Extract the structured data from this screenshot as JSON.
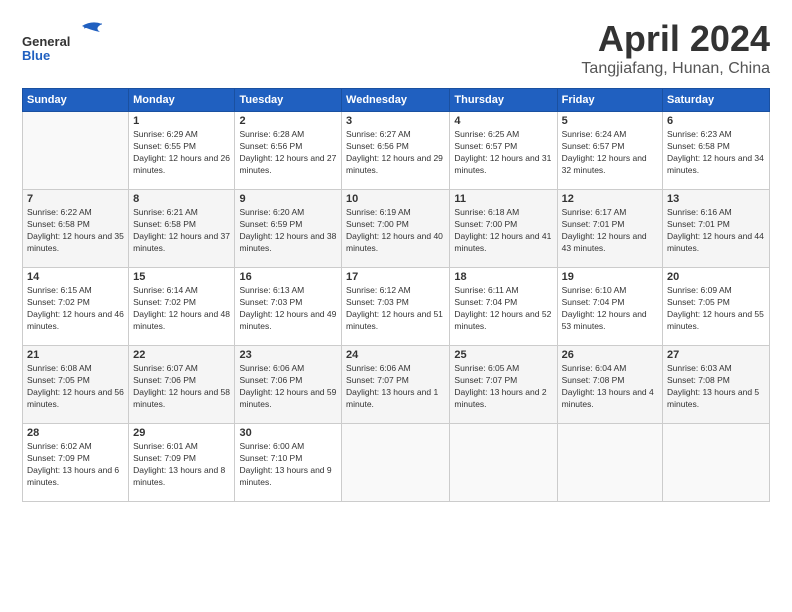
{
  "header": {
    "logo_general": "General",
    "logo_blue": "Blue",
    "month_title": "April 2024",
    "location": "Tangjiafang, Hunan, China"
  },
  "weekdays": [
    "Sunday",
    "Monday",
    "Tuesday",
    "Wednesday",
    "Thursday",
    "Friday",
    "Saturday"
  ],
  "weeks": [
    [
      {
        "day": "",
        "sunrise": "",
        "sunset": "",
        "daylight": ""
      },
      {
        "day": "1",
        "sunrise": "Sunrise: 6:29 AM",
        "sunset": "Sunset: 6:55 PM",
        "daylight": "Daylight: 12 hours and 26 minutes."
      },
      {
        "day": "2",
        "sunrise": "Sunrise: 6:28 AM",
        "sunset": "Sunset: 6:56 PM",
        "daylight": "Daylight: 12 hours and 27 minutes."
      },
      {
        "day": "3",
        "sunrise": "Sunrise: 6:27 AM",
        "sunset": "Sunset: 6:56 PM",
        "daylight": "Daylight: 12 hours and 29 minutes."
      },
      {
        "day": "4",
        "sunrise": "Sunrise: 6:25 AM",
        "sunset": "Sunset: 6:57 PM",
        "daylight": "Daylight: 12 hours and 31 minutes."
      },
      {
        "day": "5",
        "sunrise": "Sunrise: 6:24 AM",
        "sunset": "Sunset: 6:57 PM",
        "daylight": "Daylight: 12 hours and 32 minutes."
      },
      {
        "day": "6",
        "sunrise": "Sunrise: 6:23 AM",
        "sunset": "Sunset: 6:58 PM",
        "daylight": "Daylight: 12 hours and 34 minutes."
      }
    ],
    [
      {
        "day": "7",
        "sunrise": "Sunrise: 6:22 AM",
        "sunset": "Sunset: 6:58 PM",
        "daylight": "Daylight: 12 hours and 35 minutes."
      },
      {
        "day": "8",
        "sunrise": "Sunrise: 6:21 AM",
        "sunset": "Sunset: 6:58 PM",
        "daylight": "Daylight: 12 hours and 37 minutes."
      },
      {
        "day": "9",
        "sunrise": "Sunrise: 6:20 AM",
        "sunset": "Sunset: 6:59 PM",
        "daylight": "Daylight: 12 hours and 38 minutes."
      },
      {
        "day": "10",
        "sunrise": "Sunrise: 6:19 AM",
        "sunset": "Sunset: 7:00 PM",
        "daylight": "Daylight: 12 hours and 40 minutes."
      },
      {
        "day": "11",
        "sunrise": "Sunrise: 6:18 AM",
        "sunset": "Sunset: 7:00 PM",
        "daylight": "Daylight: 12 hours and 41 minutes."
      },
      {
        "day": "12",
        "sunrise": "Sunrise: 6:17 AM",
        "sunset": "Sunset: 7:01 PM",
        "daylight": "Daylight: 12 hours and 43 minutes."
      },
      {
        "day": "13",
        "sunrise": "Sunrise: 6:16 AM",
        "sunset": "Sunset: 7:01 PM",
        "daylight": "Daylight: 12 hours and 44 minutes."
      }
    ],
    [
      {
        "day": "14",
        "sunrise": "Sunrise: 6:15 AM",
        "sunset": "Sunset: 7:02 PM",
        "daylight": "Daylight: 12 hours and 46 minutes."
      },
      {
        "day": "15",
        "sunrise": "Sunrise: 6:14 AM",
        "sunset": "Sunset: 7:02 PM",
        "daylight": "Daylight: 12 hours and 48 minutes."
      },
      {
        "day": "16",
        "sunrise": "Sunrise: 6:13 AM",
        "sunset": "Sunset: 7:03 PM",
        "daylight": "Daylight: 12 hours and 49 minutes."
      },
      {
        "day": "17",
        "sunrise": "Sunrise: 6:12 AM",
        "sunset": "Sunset: 7:03 PM",
        "daylight": "Daylight: 12 hours and 51 minutes."
      },
      {
        "day": "18",
        "sunrise": "Sunrise: 6:11 AM",
        "sunset": "Sunset: 7:04 PM",
        "daylight": "Daylight: 12 hours and 52 minutes."
      },
      {
        "day": "19",
        "sunrise": "Sunrise: 6:10 AM",
        "sunset": "Sunset: 7:04 PM",
        "daylight": "Daylight: 12 hours and 53 minutes."
      },
      {
        "day": "20",
        "sunrise": "Sunrise: 6:09 AM",
        "sunset": "Sunset: 7:05 PM",
        "daylight": "Daylight: 12 hours and 55 minutes."
      }
    ],
    [
      {
        "day": "21",
        "sunrise": "Sunrise: 6:08 AM",
        "sunset": "Sunset: 7:05 PM",
        "daylight": "Daylight: 12 hours and 56 minutes."
      },
      {
        "day": "22",
        "sunrise": "Sunrise: 6:07 AM",
        "sunset": "Sunset: 7:06 PM",
        "daylight": "Daylight: 12 hours and 58 minutes."
      },
      {
        "day": "23",
        "sunrise": "Sunrise: 6:06 AM",
        "sunset": "Sunset: 7:06 PM",
        "daylight": "Daylight: 12 hours and 59 minutes."
      },
      {
        "day": "24",
        "sunrise": "Sunrise: 6:06 AM",
        "sunset": "Sunset: 7:07 PM",
        "daylight": "Daylight: 13 hours and 1 minute."
      },
      {
        "day": "25",
        "sunrise": "Sunrise: 6:05 AM",
        "sunset": "Sunset: 7:07 PM",
        "daylight": "Daylight: 13 hours and 2 minutes."
      },
      {
        "day": "26",
        "sunrise": "Sunrise: 6:04 AM",
        "sunset": "Sunset: 7:08 PM",
        "daylight": "Daylight: 13 hours and 4 minutes."
      },
      {
        "day": "27",
        "sunrise": "Sunrise: 6:03 AM",
        "sunset": "Sunset: 7:08 PM",
        "daylight": "Daylight: 13 hours and 5 minutes."
      }
    ],
    [
      {
        "day": "28",
        "sunrise": "Sunrise: 6:02 AM",
        "sunset": "Sunset: 7:09 PM",
        "daylight": "Daylight: 13 hours and 6 minutes."
      },
      {
        "day": "29",
        "sunrise": "Sunrise: 6:01 AM",
        "sunset": "Sunset: 7:09 PM",
        "daylight": "Daylight: 13 hours and 8 minutes."
      },
      {
        "day": "30",
        "sunrise": "Sunrise: 6:00 AM",
        "sunset": "Sunset: 7:10 PM",
        "daylight": "Daylight: 13 hours and 9 minutes."
      },
      {
        "day": "",
        "sunrise": "",
        "sunset": "",
        "daylight": ""
      },
      {
        "day": "",
        "sunrise": "",
        "sunset": "",
        "daylight": ""
      },
      {
        "day": "",
        "sunrise": "",
        "sunset": "",
        "daylight": ""
      },
      {
        "day": "",
        "sunrise": "",
        "sunset": "",
        "daylight": ""
      }
    ]
  ]
}
